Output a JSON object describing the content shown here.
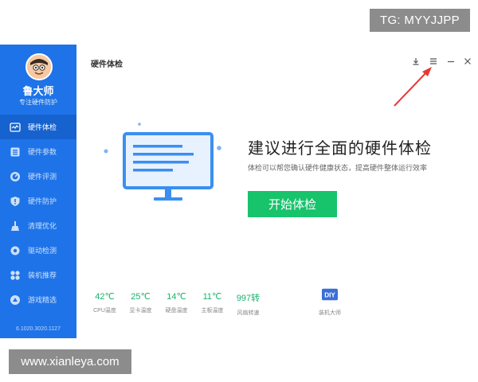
{
  "overlays": {
    "tg": "TG: MYYJJPP",
    "site": "www.xianleya.com"
  },
  "app": {
    "name": "鲁大师",
    "slogan": "专注硬件防护",
    "version": "6.1020.3020.1127",
    "window_title": "硬件体检"
  },
  "nav": [
    {
      "label": "硬件体检",
      "icon": "pulse-icon",
      "active": true
    },
    {
      "label": "硬件参数",
      "icon": "list-icon",
      "active": false
    },
    {
      "label": "硬件评测",
      "icon": "gauge-icon",
      "active": false
    },
    {
      "label": "硬件防护",
      "icon": "shield-icon",
      "active": false
    },
    {
      "label": "清理优化",
      "icon": "broom-icon",
      "active": false
    },
    {
      "label": "驱动检测",
      "icon": "gear-icon",
      "active": false
    },
    {
      "label": "装机推荐",
      "icon": "grid-icon",
      "active": false
    },
    {
      "label": "游戏精选",
      "icon": "gamepad-icon",
      "active": false
    }
  ],
  "controls": {
    "download": "download-icon",
    "menu": "menu-icon",
    "minimize": "minimize-icon",
    "close": "close-icon"
  },
  "hero": {
    "title": "建议进行全面的硬件体检",
    "subtitle": "体检可以帮您确认硬件健康状态，提高硬件整体运行效率",
    "button": "开始体检"
  },
  "stats": [
    {
      "value": "42℃",
      "label": "CPU温度"
    },
    {
      "value": "25℃",
      "label": "显卡温度"
    },
    {
      "value": "14℃",
      "label": "硬盘温度"
    },
    {
      "value": "11℃",
      "label": "主板温度"
    },
    {
      "value": "997转",
      "label": "风扇转速"
    }
  ],
  "diy": {
    "badge": "DIY",
    "label": "装机大师"
  },
  "colors": {
    "sidebar": "#1e73e8",
    "accent_green": "#17c36b",
    "annotation_red": "#e53935"
  }
}
